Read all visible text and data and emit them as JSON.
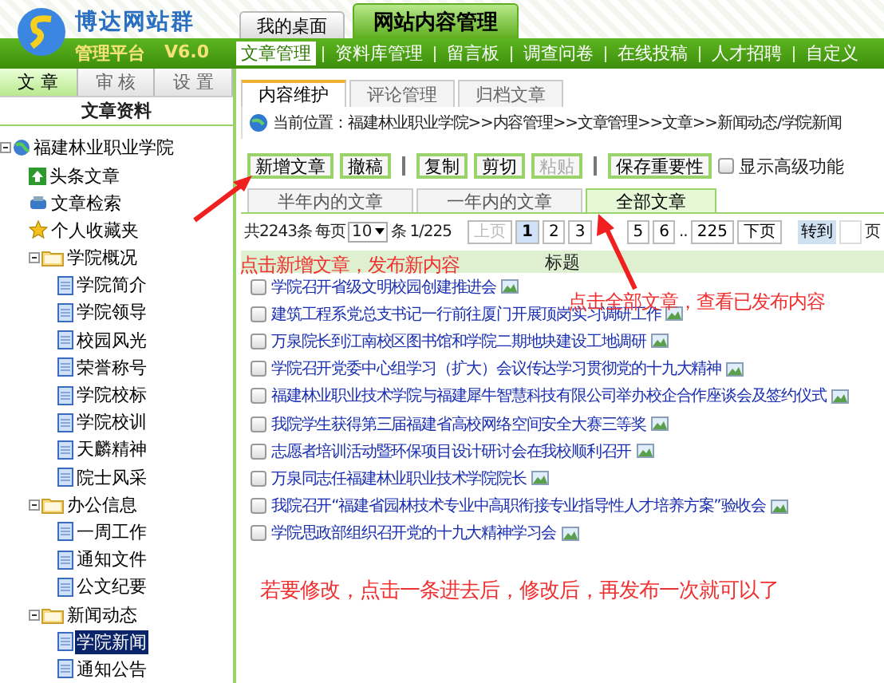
{
  "logo": {
    "name": "博达网站群",
    "subtitle": "管理平台",
    "version": "V6.0"
  },
  "top_tabs": [
    {
      "label": "我的桌面",
      "selected": false
    },
    {
      "label": "网站内容管理",
      "selected": true
    }
  ],
  "nav": [
    {
      "label": "文章管理",
      "selected": true
    },
    {
      "label": "资料库管理",
      "selected": false
    },
    {
      "label": "留言板",
      "selected": false
    },
    {
      "label": "调查问卷",
      "selected": false
    },
    {
      "label": "在线投稿",
      "selected": false
    },
    {
      "label": "人才招聘",
      "selected": false
    },
    {
      "label": "自定义",
      "selected": false
    }
  ],
  "sidebar": {
    "tabs": [
      {
        "label": "文 章",
        "selected": true
      },
      {
        "label": "审 核",
        "selected": false
      },
      {
        "label": "设 置",
        "selected": false
      }
    ],
    "title": "文章资料",
    "tree": [
      {
        "label": "福建林业职业学院",
        "kind": "site",
        "selected": false,
        "expanded": true,
        "children": [
          {
            "label": "头条文章",
            "kind": "headline",
            "selected": false
          },
          {
            "label": "文章检索",
            "kind": "search",
            "selected": false
          },
          {
            "label": "个人收藏夹",
            "kind": "favorite",
            "selected": false
          },
          {
            "label": "学院概况",
            "kind": "folder",
            "selected": false,
            "expanded": true,
            "children": [
              {
                "label": "学院简介",
                "kind": "page",
                "selected": false
              },
              {
                "label": "学院领导",
                "kind": "page",
                "selected": false
              },
              {
                "label": "校园风光",
                "kind": "page",
                "selected": false
              },
              {
                "label": "荣誉称号",
                "kind": "page",
                "selected": false
              },
              {
                "label": "学院校标",
                "kind": "page",
                "selected": false
              },
              {
                "label": "学院校训",
                "kind": "page",
                "selected": false
              },
              {
                "label": "天麟精神",
                "kind": "page",
                "selected": false
              },
              {
                "label": "院士风采",
                "kind": "page",
                "selected": false
              }
            ]
          },
          {
            "label": "办公信息",
            "kind": "folder",
            "selected": false,
            "expanded": true,
            "children": [
              {
                "label": "一周工作",
                "kind": "page",
                "selected": false
              },
              {
                "label": "通知文件",
                "kind": "page",
                "selected": false
              },
              {
                "label": "公文纪要",
                "kind": "page",
                "selected": false
              }
            ]
          },
          {
            "label": "新闻动态",
            "kind": "folder",
            "selected": false,
            "expanded": true,
            "children": [
              {
                "label": "学院新闻",
                "kind": "page",
                "selected": true
              },
              {
                "label": "通知公告",
                "kind": "page",
                "selected": false
              }
            ]
          }
        ]
      }
    ]
  },
  "content_tabs": [
    {
      "label": "内容维护",
      "selected": true
    },
    {
      "label": "评论管理",
      "selected": false
    },
    {
      "label": "归档文章",
      "selected": false
    }
  ],
  "breadcrumb": "当前位置：福建林业职业学院>>内容管理>>文章管理>>文章>>新闻动态/学院新闻",
  "toolbar": [
    {
      "label": "新增文章",
      "kind": "button",
      "disabled": false
    },
    {
      "label": "撤稿",
      "kind": "button",
      "disabled": false
    },
    {
      "kind": "separator"
    },
    {
      "label": "复制",
      "kind": "button",
      "disabled": false
    },
    {
      "label": "剪切",
      "kind": "button",
      "disabled": false
    },
    {
      "label": "粘贴",
      "kind": "button",
      "disabled": true
    },
    {
      "kind": "separator"
    },
    {
      "label": "保存重要性",
      "kind": "button",
      "disabled": false
    },
    {
      "label": "显示高级功能",
      "kind": "checkbox",
      "checked": false
    }
  ],
  "filter_tabs": [
    {
      "label": "半年内的文章",
      "selected": false
    },
    {
      "label": "一年内的文章",
      "selected": false
    },
    {
      "label": "全部文章",
      "selected": true
    }
  ],
  "pager": {
    "total": "共2243条",
    "per_page_label": "每页",
    "per_page": "10",
    "unit": "条",
    "position": "1/225",
    "pages": [
      {
        "label": "上页",
        "kind": "nav",
        "disabled": true,
        "selected": false
      },
      {
        "label": "1",
        "kind": "page",
        "disabled": false,
        "selected": true
      },
      {
        "label": "2",
        "kind": "page",
        "disabled": false,
        "selected": false
      },
      {
        "label": "3",
        "kind": "page",
        "disabled": false,
        "selected": false
      },
      {
        "label": "5",
        "kind": "page",
        "disabled": false,
        "selected": false
      },
      {
        "label": "6",
        "kind": "page",
        "disabled": false,
        "selected": false
      },
      {
        "label": "..",
        "kind": "gap"
      },
      {
        "label": "225",
        "kind": "page",
        "disabled": false,
        "selected": false
      },
      {
        "label": "下页",
        "kind": "nav",
        "disabled": false,
        "selected": false
      }
    ],
    "goto": "转到",
    "goto_unit": "页"
  },
  "table": {
    "column": "标题",
    "rows": [
      {
        "title": "学院召开省级文明校园创建推进会",
        "checked": false
      },
      {
        "title": "建筑工程系党总支书记一行前往厦门开展顶岗实习调研工作",
        "checked": false
      },
      {
        "title": "万泉院长到江南校区图书馆和学院二期地块建设工地调研",
        "checked": false
      },
      {
        "title": "学院召开党委中心组学习（扩大）会议传达学习贯彻党的十九大精神",
        "checked": false
      },
      {
        "title": "福建林业职业技术学院与福建犀牛智慧科技有限公司举办校企合作座谈会及签约仪式",
        "checked": false
      },
      {
        "title": "我院学生获得第三届福建省高校网络空间安全大赛三等奖",
        "checked": false
      },
      {
        "title": "志愿者培训活动暨环保项目设计研讨会在我校顺利召开",
        "checked": false
      },
      {
        "title": "万泉同志任福建林业职业技术学院院长",
        "checked": false
      },
      {
        "title": "我院召开“福建省园林技术专业中高职衔接专业指导性人才培养方案”验收会",
        "checked": false
      },
      {
        "title": "学院思政部组织召开党的十九大精神学习会",
        "checked": false
      }
    ]
  },
  "annotations": [
    {
      "text": "点击新增文章，发布新内容",
      "kind": "add"
    },
    {
      "text": "点击全部文章，查看已发布内容",
      "kind": "all"
    },
    {
      "text": "若要修改，点击一条进去后，修改后，再发布一次就可以了",
      "kind": "edit"
    }
  ]
}
